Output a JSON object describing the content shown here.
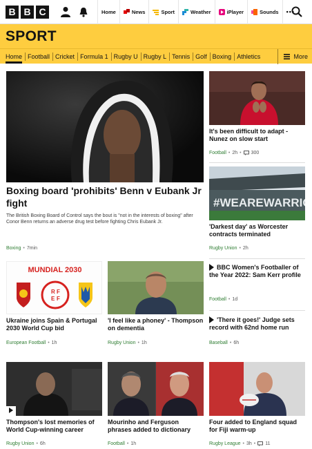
{
  "nav": {
    "items": [
      {
        "label": "Home",
        "icon": ""
      },
      {
        "label": "News",
        "icon": "news-icon"
      },
      {
        "label": "Sport",
        "icon": "sport-icon"
      },
      {
        "label": "Weather",
        "icon": "weather-icon"
      },
      {
        "label": "iPlayer",
        "icon": "iplayer-icon"
      },
      {
        "label": "Sounds",
        "icon": "sounds-icon"
      }
    ],
    "more": "•••"
  },
  "logo": [
    "B",
    "B",
    "C"
  ],
  "sport": {
    "title": "SPORT",
    "tabs": [
      "Home",
      "Football",
      "Cricket",
      "Formula 1",
      "Rugby U",
      "Rugby L",
      "Tennis",
      "Golf",
      "Boxing",
      "Athletics"
    ],
    "more_label": "More"
  },
  "colors": {
    "sport_yellow": "#fecd3f",
    "tag_green": "#2e7d32"
  },
  "lead": {
    "headline": "Boxing board 'prohibits' Benn v Eubank Jr fight",
    "summary": "The British Boxing Board of Control says the bout is \"not in the interests of boxing\" after Conor Benn returns an adverse drug test before fighting Chris Eubank Jr.",
    "tag": "Boxing",
    "time": "7min"
  },
  "side": [
    {
      "headline": "It's been difficult to adapt - Nunez on slow start",
      "tag": "Football",
      "time": "2h",
      "comments": "300"
    },
    {
      "headline": "'Darkest day' as Worcester contracts terminated",
      "tag": "Rugby Union",
      "time": "2h"
    },
    {
      "headline": "BBC Women's Footballer of the Year 2022: Sam Kerr profile",
      "tag": "Football",
      "time": "1d"
    },
    {
      "headline": "'There it goes!' Judge sets record with 62nd home run",
      "tag": "Baseball",
      "time": "6h"
    }
  ],
  "row2": [
    {
      "headline": "Ukraine joins Spain & Portugal 2030 World Cup bid",
      "tag": "European Football",
      "time": "1h",
      "banner": "MUNDIAL 2030",
      "rfef": [
        "R",
        "F",
        "E",
        "F"
      ]
    },
    {
      "headline": "'I feel like a phoney' - Thompson on dementia",
      "tag": "Rugby Union",
      "time": "1h"
    }
  ],
  "row3": [
    {
      "headline": "Thompson's lost memories of World Cup-winning career",
      "tag": "Rugby Union",
      "time": "6h"
    },
    {
      "headline": "Mourinho and Ferguson phrases added to dictionary",
      "tag": "Football",
      "time": "1h"
    },
    {
      "headline": "Four added to England squad for Fiji warm-up",
      "tag": "Rugby League",
      "time": "3h",
      "comments": "11"
    }
  ],
  "stadium_text": "#WEAREWARRIORS"
}
